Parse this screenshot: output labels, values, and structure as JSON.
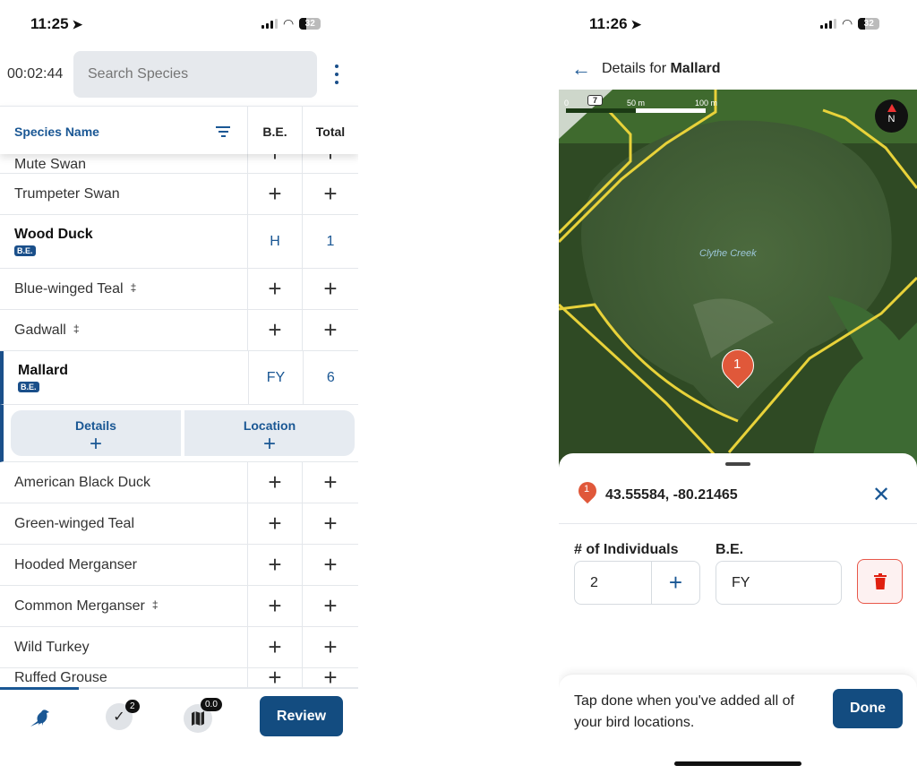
{
  "left": {
    "status": {
      "time": "11:25",
      "battery": "32"
    },
    "timer": "00:02:44",
    "search": {
      "placeholder": "Search Species"
    },
    "table": {
      "headers": {
        "name": "Species Name",
        "be": "B.E.",
        "total": "Total"
      },
      "rows": [
        {
          "name": "Mute Swan",
          "be": "+",
          "total": "+",
          "partial": true
        },
        {
          "name": "Trumpeter Swan",
          "be": "+",
          "total": "+"
        },
        {
          "name": "Wood Duck",
          "be": "H",
          "total": "1",
          "badge": "B.E.",
          "bold": true
        },
        {
          "name": "Blue-winged Teal",
          "mark": "‡",
          "be": "+",
          "total": "+"
        },
        {
          "name": "Gadwall",
          "mark": "‡",
          "be": "+",
          "total": "+"
        },
        {
          "name": "Mallard",
          "be": "FY",
          "total": "6",
          "badge": "B.E.",
          "bold": true,
          "selected": true
        },
        {
          "name": "American Black Duck",
          "be": "+",
          "total": "+"
        },
        {
          "name": "Green-winged Teal",
          "be": "+",
          "total": "+"
        },
        {
          "name": "Hooded Merganser",
          "be": "+",
          "total": "+"
        },
        {
          "name": "Common Merganser",
          "mark": "‡",
          "be": "+",
          "total": "+"
        },
        {
          "name": "Wild Turkey",
          "be": "+",
          "total": "+"
        },
        {
          "name": "Ruffed Grouse",
          "be": "+",
          "total": "+",
          "partial": true
        }
      ],
      "expanded": {
        "details": "Details",
        "location": "Location",
        "plus": "+"
      }
    },
    "bottom": {
      "checklist_count": "2",
      "map_count": "0.0",
      "review": "Review"
    },
    "accent": "#134c80"
  },
  "right": {
    "status": {
      "time": "11:26",
      "battery": "32"
    },
    "header": {
      "prefix": "Details for ",
      "species": "Mallard"
    },
    "map": {
      "scale": {
        "zero": "0",
        "zoom": "7",
        "mid": "50 m",
        "end": "100 m"
      },
      "place_label": "Clythe Creek",
      "pin_number": "1",
      "compass": "N"
    },
    "sheet": {
      "pin_number": "1",
      "coordinates": "43.55584, -80.21465",
      "individuals_label": "# of Individuals",
      "individuals_value": "2",
      "be_label": "B.E.",
      "be_value": "FY"
    },
    "footer": {
      "message": "Tap done when you've added all of your bird locations.",
      "done": "Done"
    },
    "pin_color": "#e0583a"
  }
}
